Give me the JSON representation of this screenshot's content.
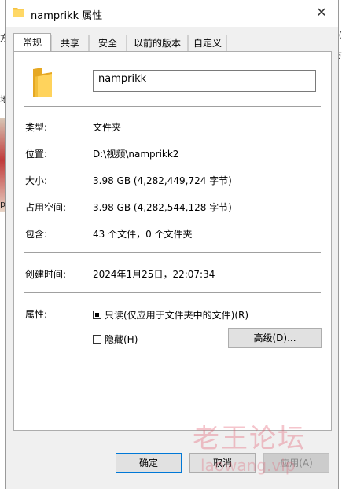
{
  "window": {
    "title": "namprikk 属性",
    "close_glyph": "✕"
  },
  "tabs": [
    {
      "label": "常规",
      "active": true
    },
    {
      "label": "共享",
      "active": false
    },
    {
      "label": "安全",
      "active": false
    },
    {
      "label": "以前的版本",
      "active": false
    },
    {
      "label": "自定义",
      "active": false
    }
  ],
  "general": {
    "name": "namprikk",
    "type_label": "类型:",
    "type_value": "文件夹",
    "location_label": "位置:",
    "location_value": "D:\\视频\\namprikk2",
    "size_label": "大小:",
    "size_value": "3.98 GB (4,282,449,724 字节)",
    "disk_label": "占用空间:",
    "disk_value": "3.98 GB (4,282,544,128 字节)",
    "contains_label": "包含:",
    "contains_value": "43 个文件，0 个文件夹",
    "created_label": "创建时间:",
    "created_value": "2024年1月25日，22:07:34",
    "attributes_label": "属性:",
    "readonly_label": "只读(仅应用于文件夹中的文件)(R)",
    "readonly_checked": true,
    "hidden_label": "隐藏(H)",
    "hidden_checked": false,
    "advanced_label": "高级(D)..."
  },
  "buttons": {
    "ok": "确定",
    "cancel": "取消",
    "apply": "应用(A)"
  },
  "background": {
    "left_fragments": [
      "方",
      "地",
      "p"
    ],
    "right_fragments": [
      "(",
      "方"
    ]
  },
  "watermark": {
    "cn": "老王论坛",
    "en": "laowang.vip"
  },
  "colors": {
    "folder": "#f5c242",
    "accent": "#0078d7"
  }
}
